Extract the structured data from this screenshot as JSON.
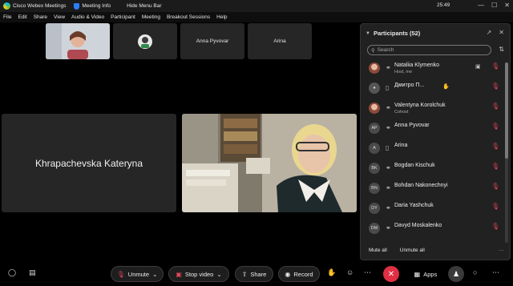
{
  "titlebar": {
    "app_title": "Cisco Webex Meetings",
    "meeting_info": "Meeting Info",
    "hide_menu": "Hide Menu Bar",
    "clock": "25:49",
    "min": "—",
    "max": "☐",
    "close": "✕"
  },
  "menu": [
    "File",
    "Edit",
    "Share",
    "View",
    "Audio & Video",
    "Participant",
    "Meeting",
    "Breakout Sessions",
    "Help"
  ],
  "tiles": {
    "t3": "Anna Pyvovar",
    "t4": "Arina",
    "big": "Khrapachevska Kateryna"
  },
  "panel": {
    "title": "Participants (52)",
    "search_placeholder": "Search",
    "mute_all": "Mute all",
    "unmute_all": "Unmute all",
    "more": "···"
  },
  "participants": [
    {
      "name": "Nataliia Klymenko",
      "role": "Host, me",
      "avatar": "",
      "camera": true
    },
    {
      "name": "Дмитро П...",
      "role": "",
      "avatar": "",
      "hand": true
    },
    {
      "name": "Valentyna Korolchuk",
      "role": "Cohost",
      "avatar": ""
    },
    {
      "name": "Anna Pyvovar",
      "role": "",
      "avatar": "AP"
    },
    {
      "name": "Arina",
      "role": "",
      "avatar": "A"
    },
    {
      "name": "Bogdan Kischuk",
      "role": "",
      "avatar": "BK"
    },
    {
      "name": "Bohdan Nakonechnyi",
      "role": "",
      "avatar": "BN"
    },
    {
      "name": "Daria Yashchuk",
      "role": "",
      "avatar": "DY"
    },
    {
      "name": "Davyd Moskalenko",
      "role": "",
      "avatar": "DM"
    }
  ],
  "toolbar": {
    "unmute": "Unmute",
    "stop_video": "Stop video",
    "share": "Share",
    "record": "Record",
    "apps": "Apps"
  },
  "colors": {
    "accent_red": "#e0465a",
    "leave_red": "#e02f44"
  }
}
